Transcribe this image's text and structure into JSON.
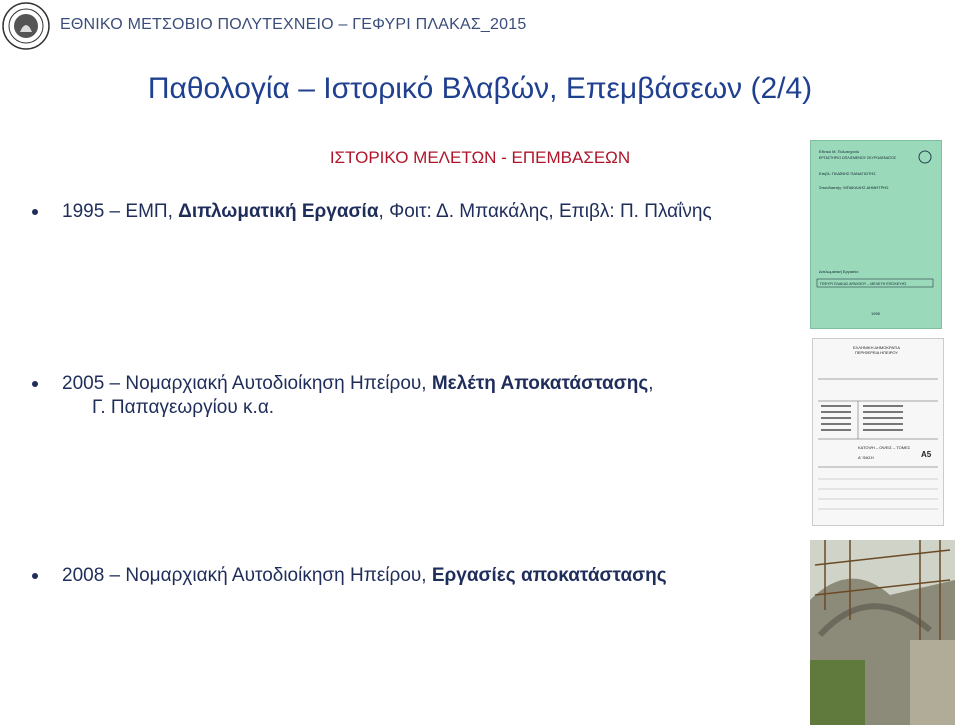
{
  "header": {
    "text": "ΕΘΝΙΚΟ ΜΕΤΣΟΒΙΟ ΠΟΛΥΤΕΧΝΕΙΟ – ΓΕΦΥΡΙ ΠΛΑΚΑΣ_2015"
  },
  "title": "Παθολογία – Ιστορικό Βλαβών, Επεμβάσεων (2/4)",
  "section_title": "ΙΣΤΟΡΙΚΟ ΜΕΛΕΤΩΝ - ΕΠΕΜΒΑΣΕΩΝ",
  "bullets": [
    {
      "pre": "1995 – ΕΜΠ, ",
      "bold": "Διπλωματική Εργασία",
      "post": ", Φοιτ: Δ. Μπακάλης, Επιβλ: Π. Πλαΐνης"
    },
    {
      "pre": "2005 – Νομαρχιακή Αυτοδιοίκηση Ηπείρου, ",
      "bold": "Μελέτη Αποκατάστασης",
      "post": ",",
      "line2": "Γ. Παπαγεωργίου κ.α."
    },
    {
      "pre": "2008 – Νομαρχιακή Αυτοδιοίκηση Ηπείρου, ",
      "bold": "Εργασίες αποκατάστασης",
      "post": ""
    }
  ],
  "images": {
    "thesis_cover": {
      "lines": [
        "Εθνικό Μ. Πολυτεχνείο",
        "ΕΡΓΑΣΤΗΡΙΟ ΩΠΛΙΣΜΕΝΟΥ ΣΚΥΡΟΔΕΜΑΤΟΣ",
        "Επιβλ: ΠΛΑΪΝΗΣ ΠΑΝΑΓΙΩΤΗΣ",
        "Σπουδαστής: ΜΠΑΚΑΛΗΣ ΔΗΜΗΤΡΗΣ",
        "Διπλωματική Εργασία:",
        "ΓΕΦΥΡΙ ΠΛΑΚΑΣ ΑΡΑΧΘΟΥ – ΜΕΛΕΤΗ ΕΠΙΣΚΕΥΗΣ",
        "1995"
      ]
    },
    "study_sheet": {
      "lines": [
        "ΕΛΛΗΝΙΚΗ ΔΗΜΟΚΡΑΤΙΑ",
        "ΠΕΡΙΦΕΡΕΙΑ ΗΠΕΙΡΟΥ",
        "ΚΑΤΟΨΗ – ΟΨΕΙΣ – ΤΟΜΕΣ",
        "Α' ΦΑΣΗ",
        "Α5"
      ]
    }
  }
}
